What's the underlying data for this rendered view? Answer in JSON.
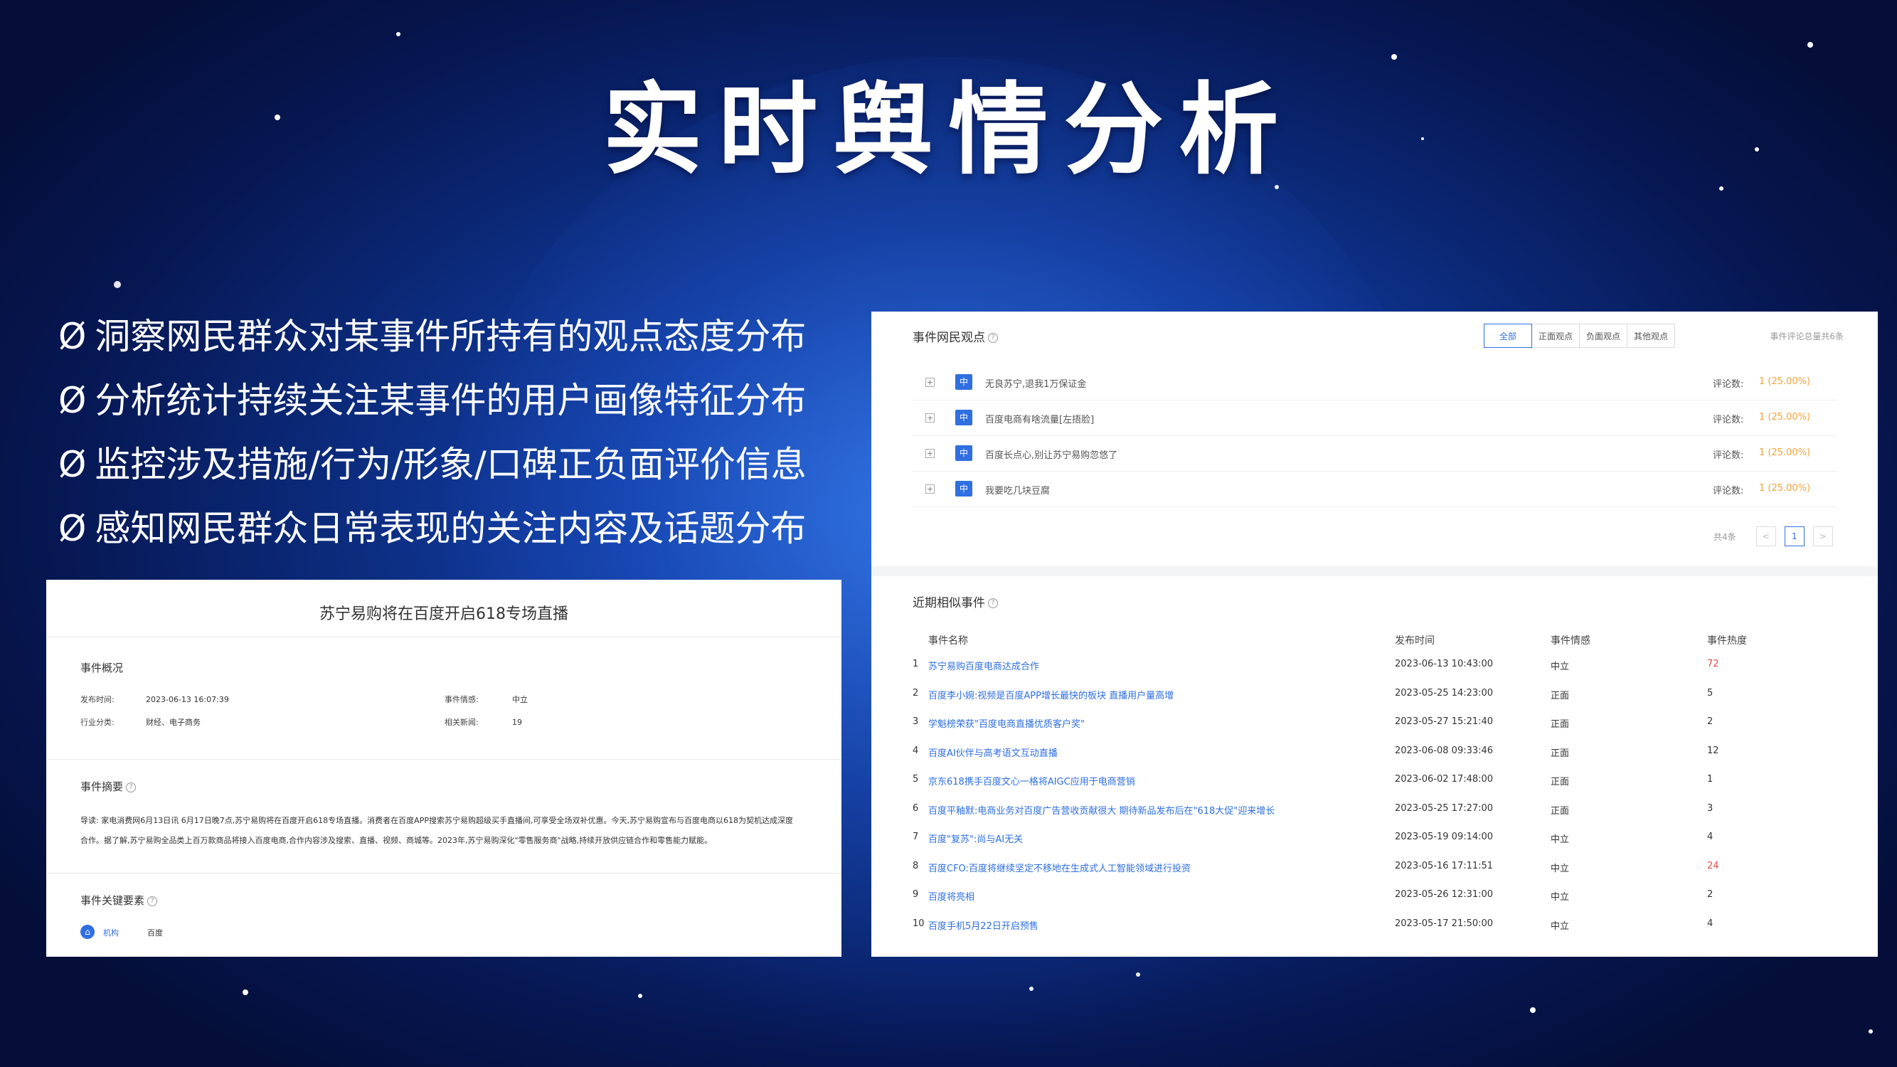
{
  "slide": {
    "title": "实时舆情分析",
    "bullet_mark": "Ø",
    "bullets": [
      "洞察网民群众对某事件所持有的观点态度分布",
      "分析统计持续关注某事件的用户画像特征分布",
      "监控涉及措施/行为/形象/口碑正负面评价信息",
      "感知网民群众日常表现的关注内容及话题分布"
    ]
  },
  "event_panel": {
    "title": "苏宁易购将在百度开启618专场直播",
    "overview": {
      "section_title": "事件概况",
      "publish_time_label": "发布时间:",
      "publish_time": "2023-06-13 16:07:39",
      "category_label": "行业分类:",
      "category": "财经、电子商务",
      "sentiment_label": "事件情感:",
      "sentiment": "中立",
      "related_label": "相关新闻:",
      "related": "19"
    },
    "summary": {
      "section_title": "事件摘要",
      "line1": "导读: 家电消费网6月13日讯 6月17日晚7点,苏宁易购将在百度开启618专场直播。消费者在百度APP搜索苏宁易购超级买手直播间,可享受全场双补优惠。今天,苏宁易购宣布与百度电商以618为契机达成深度",
      "line2": "合作。据了解,苏宁易购全品类上百万款商品将接入百度电商,合作内容涉及搜索、直播、视频、商城等。2023年,苏宁易购深化\"零售服务商\"战略,持续开放供应链合作和零售能力赋能。"
    },
    "key_elements": {
      "section_title": "事件关键要素",
      "org_label": "机构",
      "org_value": "百度"
    }
  },
  "opinions": {
    "section_title": "事件网民观点",
    "tabs": [
      "全部",
      "正面观点",
      "负面观点",
      "其他观点"
    ],
    "total_text": "事件评论总量共6条",
    "tag": "中",
    "count_label": "评论数:",
    "rows": [
      {
        "text": "无良苏宁,退我1万保证金",
        "count": "1 (25.00%)"
      },
      {
        "text": "百度电商有啥流量[左捂脸]",
        "count": "1 (25.00%)"
      },
      {
        "text": "百度长点心,别让苏宁易购忽悠了",
        "count": "1 (25.00%)"
      },
      {
        "text": "我要吃几块豆腐",
        "count": "1 (25.00%)"
      }
    ],
    "pager": {
      "total": "共4条",
      "prev": "<",
      "page": "1",
      "next": ">"
    }
  },
  "similar_events": {
    "section_title": "近期相似事件",
    "headers": {
      "name": "事件名称",
      "time": "发布时间",
      "sentiment": "事件情感",
      "heat": "事件热度"
    },
    "rows": [
      {
        "idx": "1",
        "name": "苏宁易购百度电商达成合作",
        "time": "2023-06-13 10:43:00",
        "sentiment": "中立",
        "heat": "72",
        "hot": true
      },
      {
        "idx": "2",
        "name": "百度李小婉:视频是百度APP增长最快的板块 直播用户量高增",
        "time": "2023-05-25 14:23:00",
        "sentiment": "正面",
        "heat": "5",
        "hot": false
      },
      {
        "idx": "3",
        "name": "学魁榜荣获\"百度电商直播优质客户奖\"",
        "time": "2023-05-27 15:21:40",
        "sentiment": "正面",
        "heat": "2",
        "hot": false
      },
      {
        "idx": "4",
        "name": "百度AI伙伴与高考语文互动直播",
        "time": "2023-06-08 09:33:46",
        "sentiment": "正面",
        "heat": "12",
        "hot": false
      },
      {
        "idx": "5",
        "name": "京东618携手百度文心一格将AIGC应用于电商营销",
        "time": "2023-06-02 17:48:00",
        "sentiment": "正面",
        "heat": "1",
        "hot": false
      },
      {
        "idx": "6",
        "name": "百度平釉默:电商业务对百度广告营收贡献很大 期待新品发布后在\"618大促\"迎来增长",
        "time": "2023-05-25 17:27:00",
        "sentiment": "正面",
        "heat": "3",
        "hot": false
      },
      {
        "idx": "7",
        "name": "百度\"复苏\":尚与AI无关",
        "time": "2023-05-19 09:14:00",
        "sentiment": "中立",
        "heat": "4",
        "hot": false
      },
      {
        "idx": "8",
        "name": "百度CFO:百度将继续坚定不移地在生成式人工智能领域进行投资",
        "time": "2023-05-16 17:11:51",
        "sentiment": "中立",
        "heat": "24",
        "hot": true
      },
      {
        "idx": "9",
        "name": "百度将亮相",
        "time": "2023-05-26 12:31:00",
        "sentiment": "中立",
        "heat": "2",
        "hot": false
      },
      {
        "idx": "10",
        "name": "百度手机5月22日开启预售",
        "time": "2023-05-17 21:50:00",
        "sentiment": "中立",
        "heat": "4",
        "hot": false
      }
    ]
  }
}
